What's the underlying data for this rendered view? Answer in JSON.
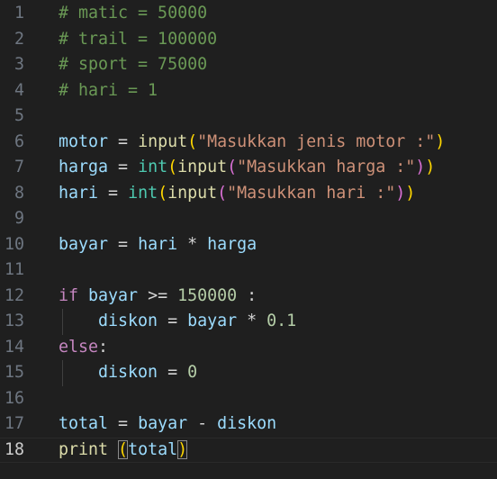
{
  "editor": {
    "lines": [
      {
        "number": "1",
        "tokens": [
          {
            "t": "# matic = 50000",
            "c": "cm"
          }
        ]
      },
      {
        "number": "2",
        "tokens": [
          {
            "t": "# trail = 100000",
            "c": "cm"
          }
        ]
      },
      {
        "number": "3",
        "tokens": [
          {
            "t": "# sport = 75000",
            "c": "cm"
          }
        ]
      },
      {
        "number": "4",
        "tokens": [
          {
            "t": "# hari = 1",
            "c": "cm"
          }
        ]
      },
      {
        "number": "5",
        "tokens": []
      },
      {
        "number": "6",
        "tokens": [
          {
            "t": "motor",
            "c": "vr"
          },
          {
            "t": " = ",
            "c": "op"
          },
          {
            "t": "input",
            "c": "fn"
          },
          {
            "t": "(",
            "c": "b1"
          },
          {
            "t": "\"Masukkan jenis motor :\"",
            "c": "st"
          },
          {
            "t": ")",
            "c": "b1"
          }
        ]
      },
      {
        "number": "7",
        "tokens": [
          {
            "t": "harga",
            "c": "vr"
          },
          {
            "t": " = ",
            "c": "op"
          },
          {
            "t": "int",
            "c": "ty"
          },
          {
            "t": "(",
            "c": "b1"
          },
          {
            "t": "input",
            "c": "fn"
          },
          {
            "t": "(",
            "c": "b2"
          },
          {
            "t": "\"Masukkan harga :\"",
            "c": "st"
          },
          {
            "t": ")",
            "c": "b2"
          },
          {
            "t": ")",
            "c": "b1"
          }
        ]
      },
      {
        "number": "8",
        "tokens": [
          {
            "t": "hari",
            "c": "vr"
          },
          {
            "t": " = ",
            "c": "op"
          },
          {
            "t": "int",
            "c": "ty"
          },
          {
            "t": "(",
            "c": "b1"
          },
          {
            "t": "input",
            "c": "fn"
          },
          {
            "t": "(",
            "c": "b2"
          },
          {
            "t": "\"Masukkan hari :\"",
            "c": "st"
          },
          {
            "t": ")",
            "c": "b2"
          },
          {
            "t": ")",
            "c": "b1"
          }
        ]
      },
      {
        "number": "9",
        "tokens": []
      },
      {
        "number": "10",
        "tokens": [
          {
            "t": "bayar",
            "c": "vr"
          },
          {
            "t": " = ",
            "c": "op"
          },
          {
            "t": "hari",
            "c": "vr"
          },
          {
            "t": " * ",
            "c": "op"
          },
          {
            "t": "harga",
            "c": "vr"
          }
        ]
      },
      {
        "number": "11",
        "tokens": []
      },
      {
        "number": "12",
        "tokens": [
          {
            "t": "if",
            "c": "kw"
          },
          {
            "t": " ",
            "c": "op"
          },
          {
            "t": "bayar",
            "c": "vr"
          },
          {
            "t": " >= ",
            "c": "op"
          },
          {
            "t": "150000",
            "c": "nu"
          },
          {
            "t": " :",
            "c": "op"
          }
        ]
      },
      {
        "number": "13",
        "guide": true,
        "tokens": [
          {
            "t": "    ",
            "c": "op"
          },
          {
            "t": "diskon",
            "c": "vr"
          },
          {
            "t": " = ",
            "c": "op"
          },
          {
            "t": "bayar",
            "c": "vr"
          },
          {
            "t": " * ",
            "c": "op"
          },
          {
            "t": "0.1",
            "c": "nu"
          }
        ]
      },
      {
        "number": "14",
        "tokens": [
          {
            "t": "else",
            "c": "kw"
          },
          {
            "t": ":",
            "c": "op"
          }
        ]
      },
      {
        "number": "15",
        "guide": true,
        "tokens": [
          {
            "t": "    ",
            "c": "op"
          },
          {
            "t": "diskon",
            "c": "vr"
          },
          {
            "t": " = ",
            "c": "op"
          },
          {
            "t": "0",
            "c": "nu"
          }
        ]
      },
      {
        "number": "16",
        "tokens": []
      },
      {
        "number": "17",
        "tokens": [
          {
            "t": "total",
            "c": "vr"
          },
          {
            "t": " = ",
            "c": "op"
          },
          {
            "t": "bayar",
            "c": "vr"
          },
          {
            "t": " - ",
            "c": "op"
          },
          {
            "t": "diskon",
            "c": "vr"
          }
        ]
      },
      {
        "number": "18",
        "current": true,
        "tokens": [
          {
            "t": "print",
            "c": "fn"
          },
          {
            "t": " ",
            "c": "op"
          },
          {
            "t": "(",
            "c": "b1",
            "match": true
          },
          {
            "t": "total",
            "c": "vr"
          },
          {
            "t": ")",
            "c": "b1",
            "match": true
          }
        ]
      }
    ]
  }
}
